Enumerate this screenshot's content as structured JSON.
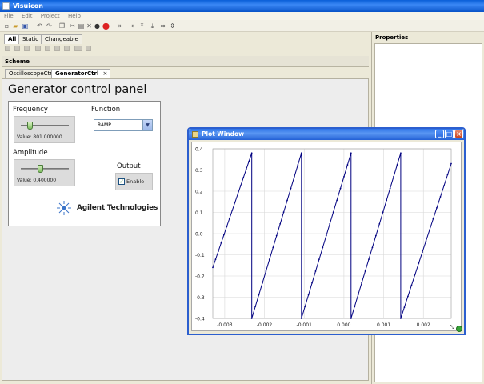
{
  "app": {
    "title": "Visuicon"
  },
  "menu": [
    "File",
    "Edit",
    "Project",
    "Help"
  ],
  "palette_tabs": [
    "All",
    "Static",
    "Changeable"
  ],
  "scheme": {
    "title": "Scheme"
  },
  "doc_tabs": [
    {
      "label": "OscilloscopeCtrl",
      "active": false
    },
    {
      "label": "GeneratorCtrl",
      "active": true
    }
  ],
  "doc_tab_close": "×",
  "properties": {
    "title": "Properties"
  },
  "panel": {
    "title": "Generator control panel",
    "frequency": {
      "label": "Frequency",
      "value_text": "Value: 801.000000",
      "level": 0.18
    },
    "function": {
      "label": "Function",
      "selected": "RAMP"
    },
    "amplitude": {
      "label": "Amplitude",
      "value_text": "Value: 0.400000",
      "level": 0.4
    },
    "output": {
      "label": "Output",
      "checkbox_label": "Enable",
      "checked": true
    },
    "logo_text": "Agilent Technologies"
  },
  "plot_window": {
    "title": "Plot Window",
    "accent": "#000080"
  },
  "chart_data": {
    "type": "line",
    "title": "",
    "xlabel": "",
    "ylabel": "",
    "xlim": [
      -0.0033,
      0.0027
    ],
    "ylim": [
      -0.4,
      0.4
    ],
    "x_ticks": [
      -0.003,
      -0.002,
      -0.001,
      0.0,
      0.001,
      0.002
    ],
    "x_tick_labels": [
      "-0.003",
      "-0.002",
      "-0.001",
      "0.000",
      "0.001",
      "0.002"
    ],
    "y_ticks": [
      0.4,
      0.3,
      0.2,
      0.1,
      0.0,
      -0.1,
      -0.2,
      -0.3,
      -0.4
    ],
    "y_tick_labels": [
      "0.4",
      "0.3",
      "0.2",
      "0.1",
      "0.0",
      "-0.1",
      "-0.2",
      "-0.3",
      "-0.4"
    ],
    "grid": true,
    "series": [
      {
        "color": "#000080",
        "x": [
          -0.0033,
          -0.00232,
          -0.00232,
          -0.00107,
          -0.00107,
          0.00018,
          0.00018,
          0.00143,
          0.00143,
          0.0027
        ],
        "x_sawtooth": {
          "period": 0.00125,
          "start_x": -0.0033,
          "start_y": -0.16,
          "reset_x": [
            -0.00232,
            -0.00107,
            0.00018,
            0.00143
          ]
        },
        "y": [
          -0.16,
          0.38,
          -0.4,
          0.38,
          -0.4,
          0.38,
          -0.4,
          0.38,
          -0.4,
          0.33
        ]
      }
    ]
  }
}
